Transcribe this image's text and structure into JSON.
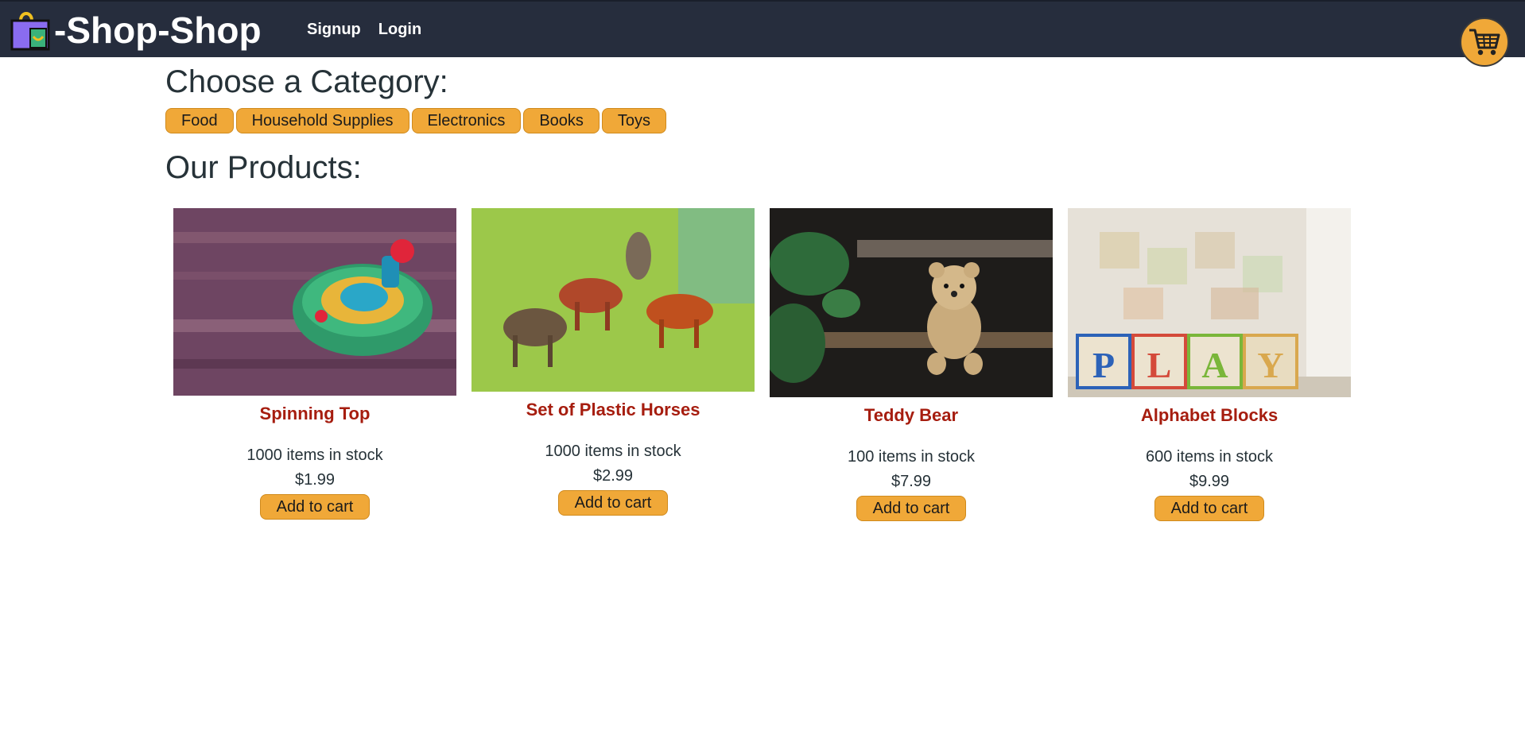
{
  "header": {
    "brand_text": "-Shop-Shop",
    "nav": {
      "signup": "Signup",
      "login": "Login"
    }
  },
  "categories": {
    "title": "Choose a Category:",
    "items": [
      "Food",
      "Household Supplies",
      "Electronics",
      "Books",
      "Toys"
    ]
  },
  "products": {
    "title": "Our Products:",
    "items": [
      {
        "name": "Spinning Top",
        "stock": "1000 items in stock",
        "price": "$1.99",
        "add_label": "Add to cart",
        "image": "spinning-top-photo"
      },
      {
        "name": "Set of Plastic Horses",
        "stock": "1000 items in stock",
        "price": "$2.99",
        "add_label": "Add to cart",
        "image": "plastic-horses-photo"
      },
      {
        "name": "Teddy Bear",
        "stock": "100 items in stock",
        "price": "$7.99",
        "add_label": "Add to cart",
        "image": "teddy-bear-photo"
      },
      {
        "name": "Alphabet Blocks",
        "stock": "600 items in stock",
        "price": "$9.99",
        "add_label": "Add to cart",
        "image": "alphabet-blocks-photo"
      }
    ]
  },
  "colors": {
    "navbar": "#262d3d",
    "accent": "#f0a838",
    "product_name": "#a61d0f",
    "text": "#263238"
  },
  "icons": {
    "logo": "shopping-bag-icon",
    "cart": "shopping-cart-icon"
  }
}
